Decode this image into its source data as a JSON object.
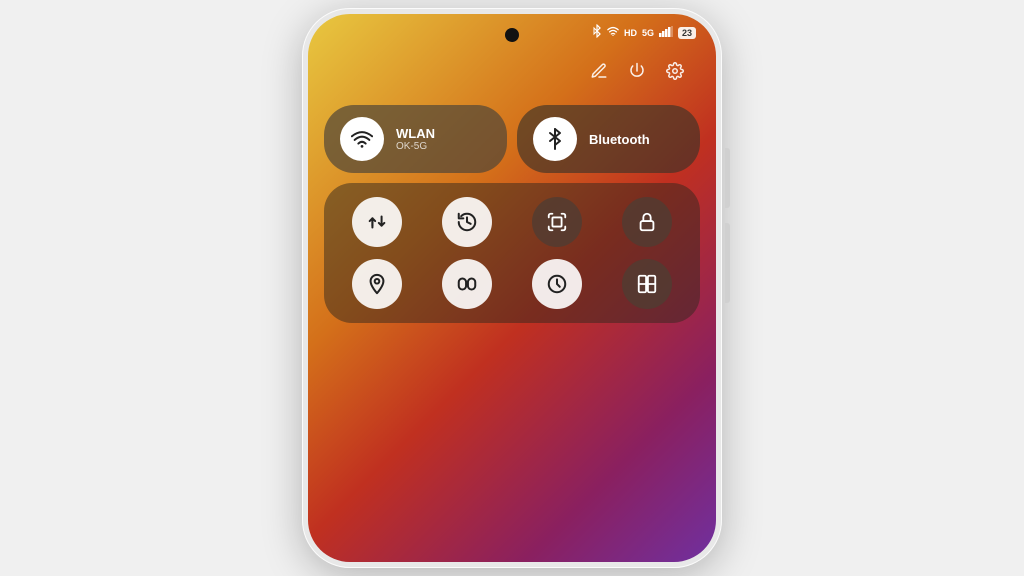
{
  "phone": {
    "status_bar": {
      "battery": "23",
      "network": "5G"
    },
    "edit_row": {
      "pencil_icon": "✏",
      "power_icon": "⏻",
      "settings_icon": "⚙"
    },
    "wlan_tile": {
      "title": "WLAN",
      "subtitle": "OK-5G"
    },
    "bluetooth_tile": {
      "title": "Bluetooth",
      "subtitle": ""
    },
    "quick_tiles": [
      {
        "name": "data-transfer",
        "type": "light"
      },
      {
        "name": "refresh",
        "type": "light"
      },
      {
        "name": "screenshot",
        "type": "dark"
      },
      {
        "name": "lock-rotation",
        "type": "dark"
      },
      {
        "name": "location",
        "type": "light"
      },
      {
        "name": "dolby",
        "type": "light"
      },
      {
        "name": "clock",
        "type": "light"
      },
      {
        "name": "multi-window",
        "type": "dark"
      }
    ]
  }
}
